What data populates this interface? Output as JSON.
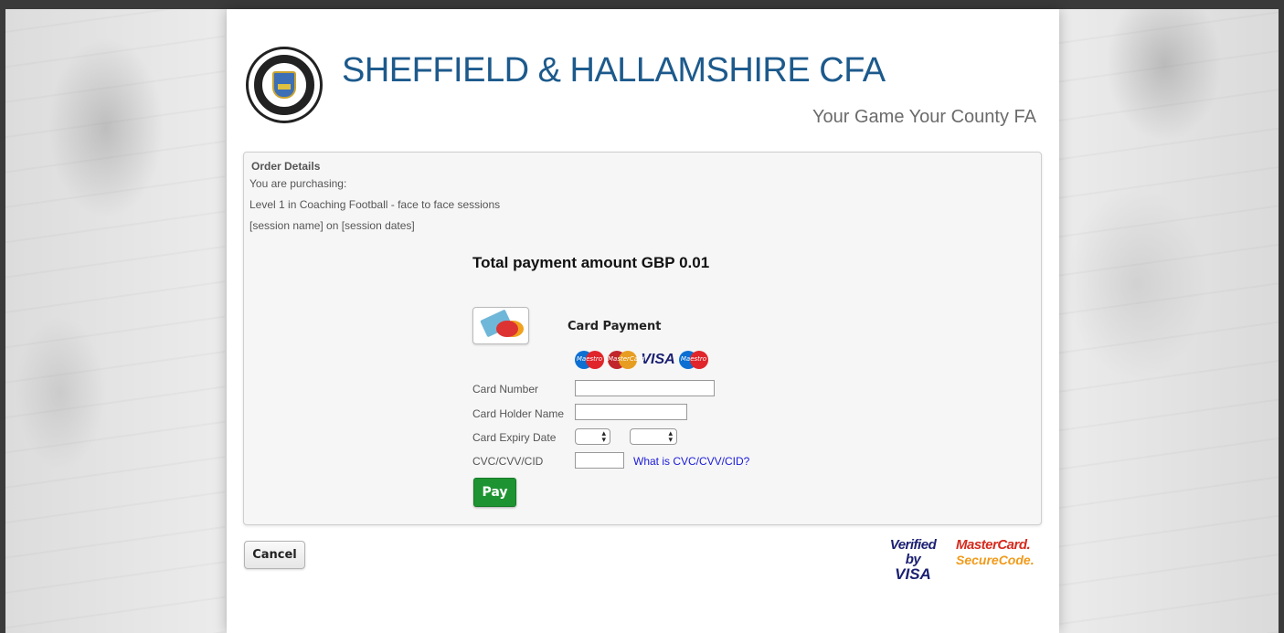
{
  "header": {
    "title": "SHEFFIELD & HALLAMSHIRE CFA",
    "tagline": "Your Game Your County FA",
    "logo_icon": "sheffield-hallamshire-crest"
  },
  "order": {
    "heading": "Order Details",
    "purchasing_label": "You are purchasing:",
    "item": "Level 1 in Coaching Football - face to face sessions",
    "session": "[session name] on [session dates]"
  },
  "payment": {
    "total": "Total payment amount GBP 0.01",
    "card_payment_label": "Card Payment",
    "brands": [
      "Maestro",
      "MasterCard",
      "VISA",
      "Maestro"
    ],
    "fields": {
      "card_number_label": "Card Number",
      "card_number_value": "",
      "card_holder_label": "Card Holder Name",
      "card_holder_value": "",
      "expiry_label": "Card Expiry Date",
      "expiry_separator": "/",
      "cvc_label": "CVC/CVV/CID",
      "cvc_value": "",
      "cvc_help_link": "What is CVC/CVV/CID?"
    },
    "pay_label": "Pay"
  },
  "footer": {
    "cancel_label": "Cancel",
    "verified_by": "Verified by",
    "visa": "VISA",
    "mastercard": "MasterCard.",
    "securecode": "SecureCode."
  },
  "colors": {
    "title_blue": "#1d5a8c",
    "pay_green": "#1d9431",
    "link_blue": "#1a1adb"
  }
}
